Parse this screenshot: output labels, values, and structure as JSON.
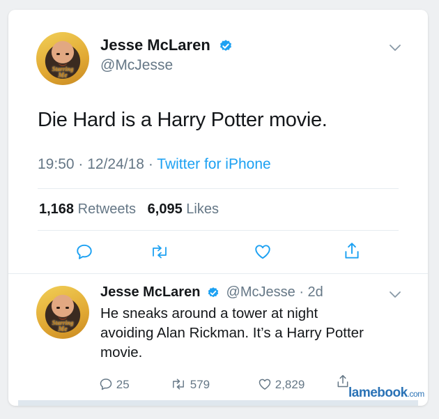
{
  "tweet": {
    "name": "Jesse McLaren",
    "handle": "@McJesse",
    "avatar_text": [
      "Starring",
      "Me"
    ],
    "text": "Die Hard is a Harry Potter movie.",
    "time": "19:50",
    "date": "12/24/18",
    "source": "Twitter for iPhone",
    "retweets_count": "1,168",
    "retweets_label": "Retweets",
    "likes_count": "6,095",
    "likes_label": "Likes"
  },
  "reply": {
    "name": "Jesse McLaren",
    "handle": "@McJesse",
    "age": "2d",
    "avatar_text": [
      "Starring",
      "Me"
    ],
    "text_lines": [
      "He sneaks around a tower at night",
      "avoiding Alan Rickman. It’s a Harry Potter",
      "movie."
    ],
    "replies": "25",
    "retweets": "579",
    "likes": "2,829"
  },
  "watermark": {
    "brand": "lamebook",
    "domain": ".com"
  },
  "colors": {
    "accent": "#1da1f2",
    "text": "#14171a",
    "muted": "#657786"
  },
  "icons": [
    "verified-badge-icon",
    "chevron-down-icon",
    "reply-icon",
    "retweet-icon",
    "like-icon",
    "share-icon"
  ]
}
